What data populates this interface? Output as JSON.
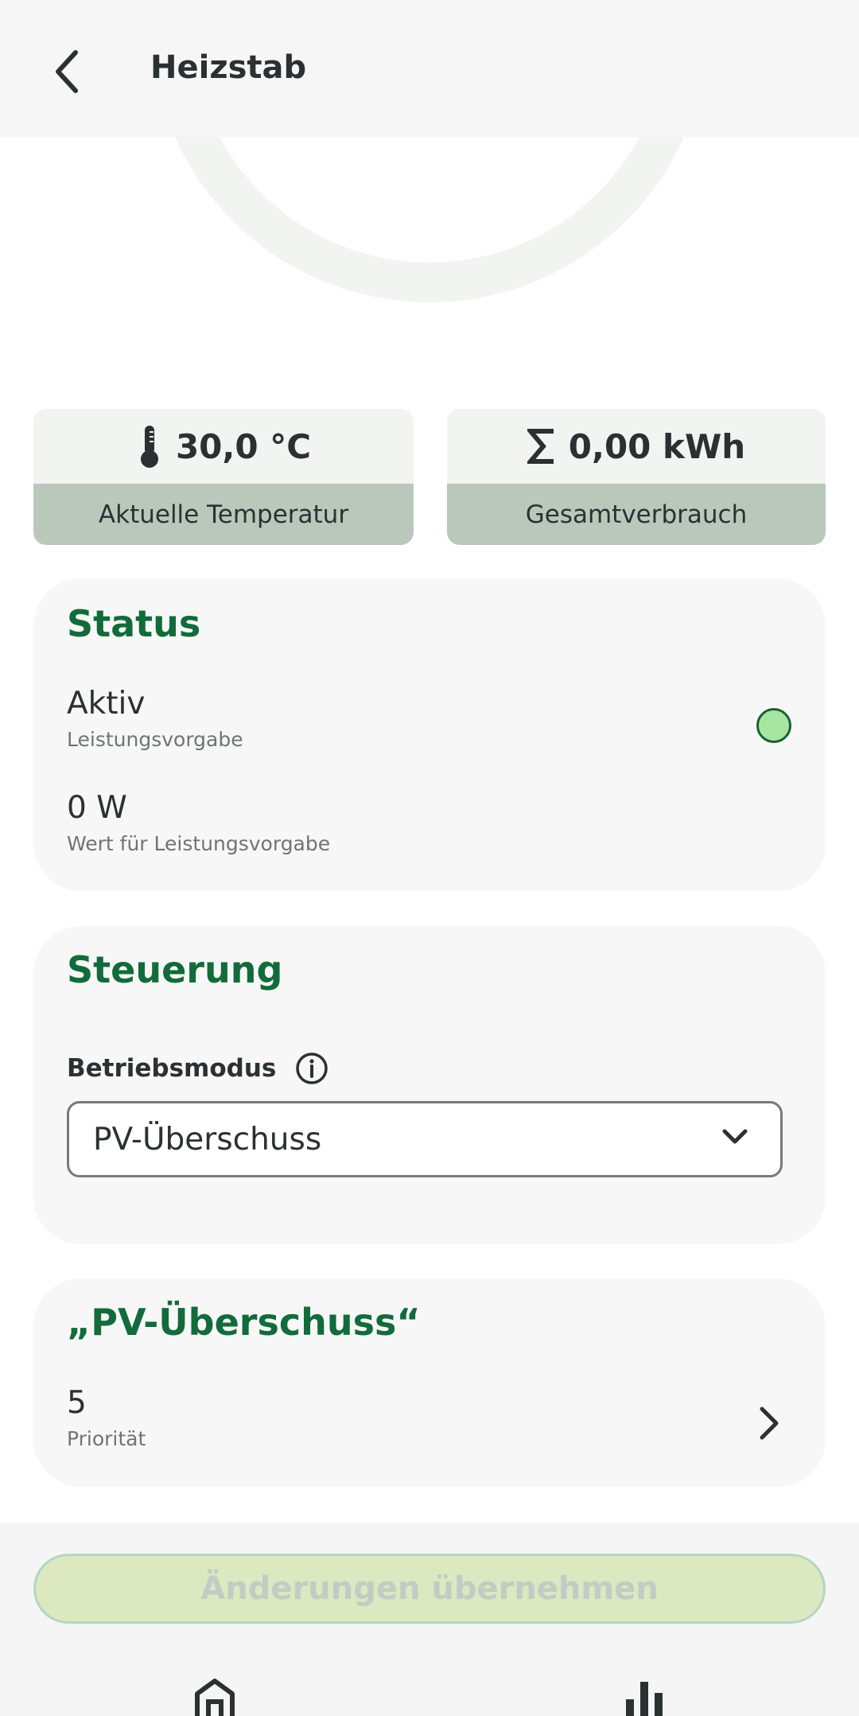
{
  "header": {
    "title": "Heizstab"
  },
  "tiles": [
    {
      "value": "30,0 °C",
      "label": "Aktuelle Temperatur",
      "icon": "thermometer-icon"
    },
    {
      "value": "0,00 kWh",
      "label": "Gesamtverbrauch",
      "icon": "sigma-icon"
    }
  ],
  "status": {
    "title": "Status",
    "items": [
      {
        "value": "Aktiv",
        "label": "Leistungsvorgabe"
      },
      {
        "value": "0 W",
        "label": "Wert für Leistungsvorgabe"
      }
    ],
    "indicator_color": "#a7e6a2"
  },
  "control": {
    "title": "Steuerung",
    "field_label": "Betriebsmodus",
    "selected": "PV-Überschuss"
  },
  "mode_section": {
    "title": "„PV-Überschuss“",
    "priority_value": "5",
    "priority_label": "Priorität"
  },
  "apply_button": "Änderungen übernehmen",
  "colors": {
    "accent": "#126b3a",
    "tile_label_bg": "#b9c8bb",
    "button_bg": "#dbe8c0"
  }
}
